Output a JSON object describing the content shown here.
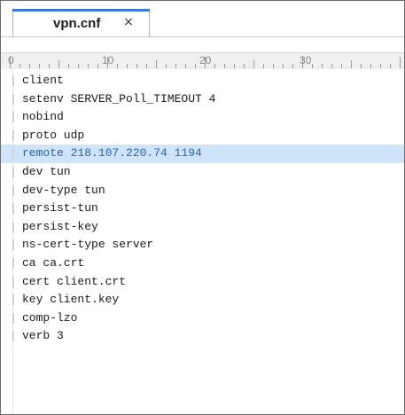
{
  "tab": {
    "filename": "vpn.cnf",
    "close_glyph": "×"
  },
  "ruler": {
    "labels": [
      "0",
      "10",
      "20",
      "30"
    ]
  },
  "editor": {
    "highlight_color": "#cde4f9",
    "highlighted_line_index": 4,
    "lines": [
      "client",
      "setenv SERVER_Poll_TIMEOUT 4",
      "nobind",
      "proto udp",
      "remote 218.107.220.74 1194",
      "dev tun",
      "dev-type tun",
      "persist-tun",
      "persist-key",
      "ns-cert-type server",
      "ca ca.crt",
      "cert client.crt",
      "key client.key",
      "comp-lzo",
      "verb 3"
    ]
  }
}
